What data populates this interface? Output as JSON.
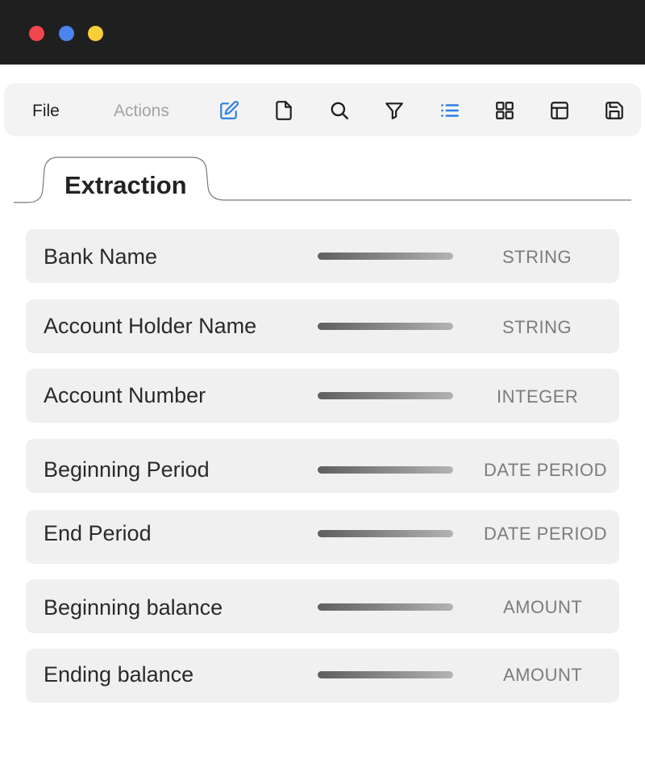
{
  "menu": {
    "file_label": "File",
    "actions_label": "Actions"
  },
  "toolbar": {
    "icons": [
      "edit-icon",
      "document-icon",
      "search-icon",
      "filter-icon",
      "list-icon",
      "grid-icon",
      "layout-icon",
      "save-icon"
    ],
    "accent_color": "#2f7ee6",
    "icon_color": "#1f1f1f"
  },
  "tabs": [
    {
      "label": "Extraction"
    }
  ],
  "fields": [
    {
      "name": "Bank Name",
      "type": "STRING"
    },
    {
      "name": "Account Holder Name",
      "type": "STRING"
    },
    {
      "name": "Account Number",
      "type": "INTEGER"
    },
    {
      "name": "Beginning Period",
      "type": "DATE PERIOD"
    },
    {
      "name": "End Period",
      "type": "DATE PERIOD"
    },
    {
      "name": "Beginning balance",
      "type": "AMOUNT"
    },
    {
      "name": "Ending balance",
      "type": "AMOUNT"
    }
  ]
}
